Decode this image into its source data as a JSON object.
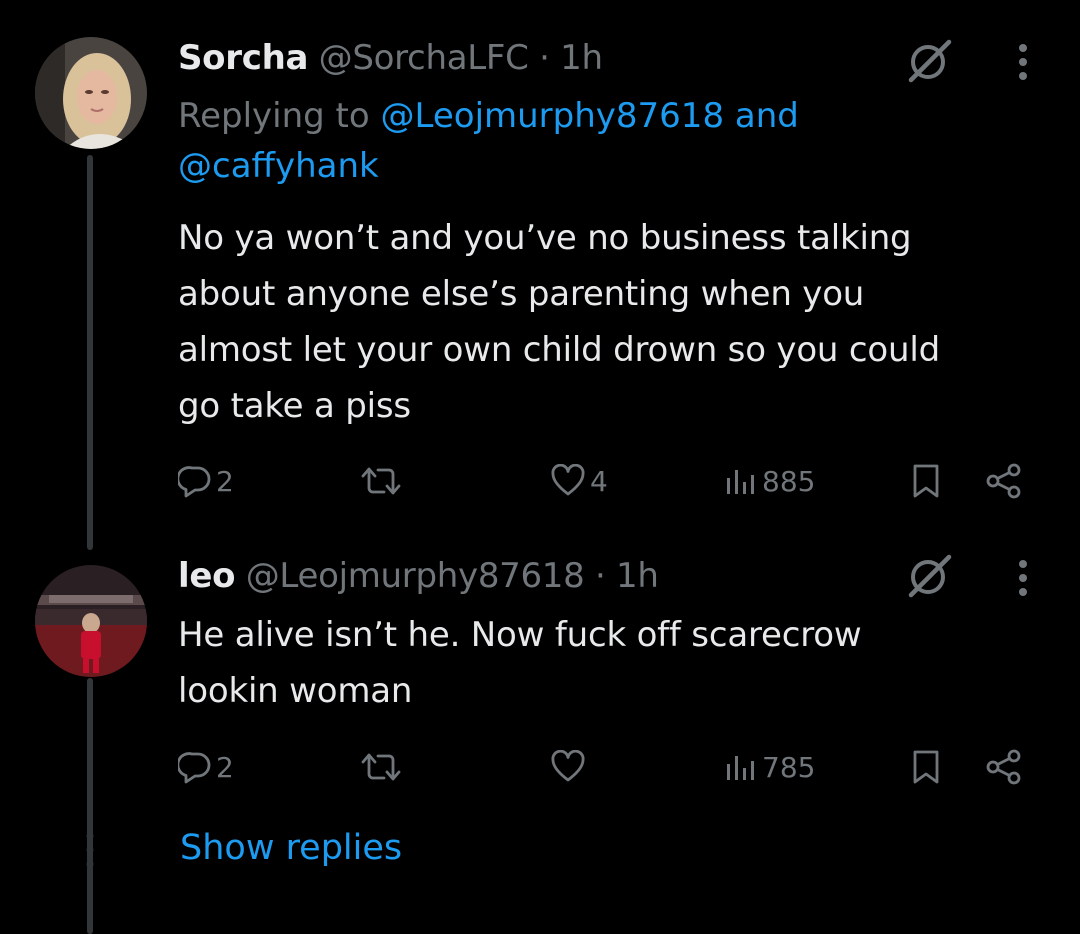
{
  "tweets": [
    {
      "display_name": "Sorcha",
      "handle": "@SorchaLFC",
      "separator": "·",
      "time": "1h",
      "reply_prefix": "Replying to",
      "reply_mention_1": "@Leojmurphy87618",
      "reply_and": "and",
      "reply_mention_2": "@caffyhank",
      "body_lines": [
        "No ya won’t and you’ve no business talking",
        "about anyone else’s parenting when you",
        "almost let your own child drown so you could",
        "go take a piss"
      ],
      "replies_count": "2",
      "likes_count": "4",
      "views_count": "885",
      "avatar_icon": "avatar-photo"
    },
    {
      "display_name": "leo",
      "handle": "@Leojmurphy87618",
      "separator": "·",
      "time": "1h",
      "body_lines": [
        "He alive isn’t he. Now fuck off scarecrow",
        "lookin woman"
      ],
      "replies_count": "2",
      "likes_count": "",
      "views_count": "785",
      "avatar_icon": "avatar-photo"
    }
  ],
  "show_replies_label": "Show replies",
  "colors": {
    "background": "#000000",
    "text_primary": "#e7e9ea",
    "text_secondary": "#71767b",
    "accent": "#1d9bf0"
  }
}
